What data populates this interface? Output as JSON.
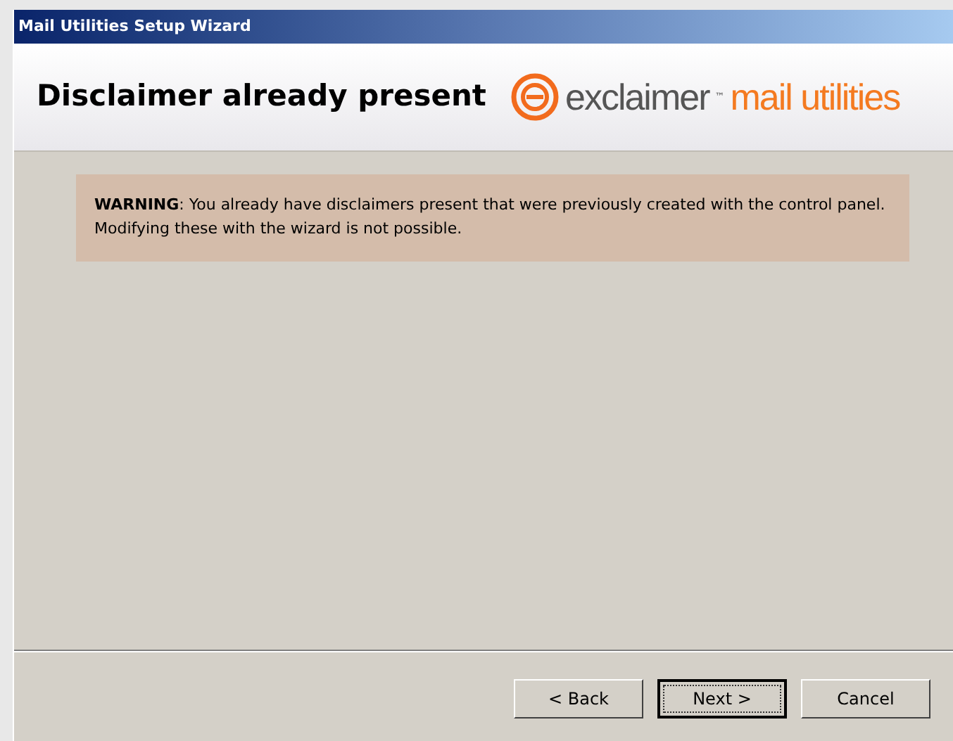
{
  "window": {
    "title": "Mail Utilities Setup Wizard"
  },
  "header": {
    "title": "Disclaimer already present",
    "logo": {
      "brand": "exclaimer",
      "trademark": "™",
      "product": "mail utilities"
    }
  },
  "warning": {
    "text": "**WARNING**: You already have disclaimers present that were previously created with the control panel. Modifying these with the wizard is not possible."
  },
  "buttons": [
    {
      "label": "< Back",
      "default": false
    },
    {
      "label": "Next >",
      "default": true
    },
    {
      "label": "Cancel",
      "default": false
    }
  ]
}
